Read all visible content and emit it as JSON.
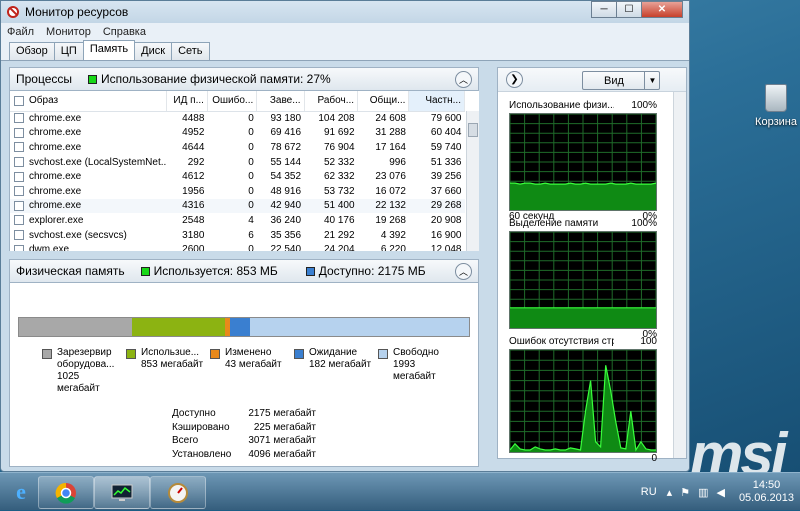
{
  "window": {
    "title": "Монитор ресурсов",
    "buttons": {
      "minimize": "─",
      "maximize": "☐",
      "close": "✕"
    }
  },
  "menu": [
    "Файл",
    "Монитор",
    "Справка"
  ],
  "tabs": [
    "Обзор",
    "ЦП",
    "Память",
    "Диск",
    "Сеть"
  ],
  "active_tab": "Память",
  "processes": {
    "title": "Процессы",
    "usage_label": "Использование физической памяти: 27%",
    "usage_color": "#18d818",
    "columns": [
      "Образ",
      "ИД п...",
      "Ошибо...",
      "Заве...",
      "Рабоч...",
      "Общи...",
      "Частн..."
    ],
    "rows": [
      [
        "chrome.exe",
        "4488",
        "0",
        "93 180",
        "104 208",
        "24 608",
        "79 600"
      ],
      [
        "chrome.exe",
        "4952",
        "0",
        "69 416",
        "91 692",
        "31 288",
        "60 404"
      ],
      [
        "chrome.exe",
        "4644",
        "0",
        "78 672",
        "76 904",
        "17 164",
        "59 740"
      ],
      [
        "svchost.exe (LocalSystemNet...",
        "292",
        "0",
        "55 144",
        "52 332",
        "996",
        "51 336"
      ],
      [
        "chrome.exe",
        "4612",
        "0",
        "54 352",
        "62 332",
        "23 076",
        "39 256"
      ],
      [
        "chrome.exe",
        "1956",
        "0",
        "48 916",
        "53 732",
        "16 072",
        "37 660"
      ],
      [
        "chrome.exe",
        "4316",
        "0",
        "42 940",
        "51 400",
        "22 132",
        "29 268"
      ],
      [
        "explorer.exe",
        "2548",
        "4",
        "36 240",
        "40 176",
        "19 268",
        "20 908"
      ],
      [
        "svchost.exe (secsvcs)",
        "3180",
        "6",
        "35 356",
        "21 292",
        "4 392",
        "16 900"
      ],
      [
        "dwm.exe",
        "2600",
        "0",
        "22 540",
        "24 204",
        "6 220",
        "12 048"
      ]
    ]
  },
  "physical": {
    "title": "Физическая память",
    "used_label": "Используется: 853 МБ",
    "available_label": "Доступно: 2175 МБ",
    "segments": [
      {
        "name": "Зарезервировано оборудованием",
        "label": "Зарезервир оборудова...",
        "value": "1025 мегабайт",
        "mb": 1025,
        "color": "#a8a8a8"
      },
      {
        "name": "Используется",
        "label": "Использue...",
        "value": "853 мегабайт",
        "mb": 853,
        "color": "#8cb312"
      },
      {
        "name": "Изменено",
        "label": "Изменено",
        "value": "43 мегабайт",
        "mb": 43,
        "color": "#e8891b"
      },
      {
        "name": "Ожидание",
        "label": "Ожидание",
        "value": "182 мегабайт",
        "mb": 182,
        "color": "#3a7fd0"
      },
      {
        "name": "Свободно",
        "label": "Свободно",
        "value": "1993 мегабайт",
        "mb": 1993,
        "color": "#b6d2ee"
      }
    ],
    "stats": [
      {
        "k": "Доступно",
        "v": "2175 мегабайт"
      },
      {
        "k": "Кэшировано",
        "v": "225 мегабайт"
      },
      {
        "k": "Всего",
        "v": "3071 мегабайт"
      },
      {
        "k": "Установлено",
        "v": "4096 мегабайт"
      }
    ]
  },
  "right_panel": {
    "view_label": "Вид",
    "graphs": [
      {
        "title": "Использование физи...",
        "max": "100%",
        "left_footer": "60 секунд",
        "right_footer": "0%",
        "series": [
          28,
          28,
          27,
          28,
          28,
          27,
          27,
          28,
          27,
          27,
          27,
          27,
          28,
          27,
          27,
          28,
          27,
          27,
          27,
          27,
          28,
          27,
          27,
          27,
          28,
          27,
          27,
          27,
          27,
          28
        ]
      },
      {
        "title": "Выделение памяти",
        "max": "100%",
        "left_footer": "",
        "right_footer": "0%",
        "series": [
          21,
          21,
          21,
          21,
          21,
          21,
          21,
          21,
          21,
          21,
          21,
          21,
          21,
          21,
          21,
          21,
          21,
          21,
          21,
          21,
          21,
          21,
          21,
          21,
          21,
          21,
          21,
          21,
          21,
          21
        ]
      },
      {
        "title": "Ошибок отсутствия стр...",
        "max": "100",
        "left_footer": "",
        "right_footer": "0",
        "series": [
          2,
          8,
          3,
          2,
          2,
          5,
          3,
          2,
          2,
          3,
          2,
          2,
          4,
          3,
          2,
          40,
          70,
          10,
          5,
          85,
          60,
          30,
          4,
          3,
          40,
          2,
          10,
          3,
          2,
          2
        ]
      }
    ]
  },
  "desktop": {
    "recycle_label": "Корзина",
    "brand": "msi"
  },
  "taskbar": {
    "lang": "RU",
    "time": "14:50",
    "date": "05.06.2013"
  }
}
